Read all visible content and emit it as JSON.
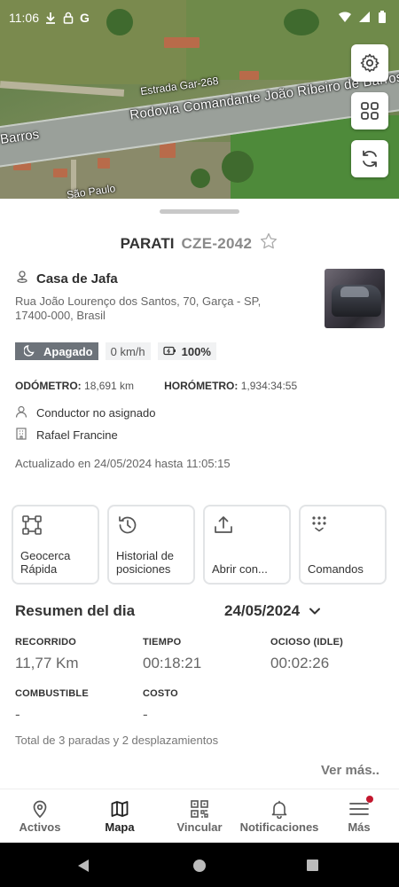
{
  "status_bar": {
    "time": "11:06",
    "google_letter": "G"
  },
  "map": {
    "labels": {
      "estrada": "Estrada Gar-268",
      "rodovia": "Rodovia Comandante João Ribeiro de Barros",
      "barros": "Barros",
      "sao_paulo": "São Paulo"
    },
    "buttons": [
      "gear-icon",
      "grid-icon",
      "refresh-icon"
    ]
  },
  "vehicle": {
    "name": "PARATI",
    "plate": "CZE-2042",
    "place": "Casa de Jafa",
    "address": "Rua João Lourenço dos Santos, 70, Garça - SP, 17400-000, Brasil",
    "status": "Apagado",
    "speed": "0 km/h",
    "battery": "100%",
    "odometer_label": "ODÓMETRO:",
    "odometer_value": "18,691 km",
    "hourmeter_label": "HORÓMETRO:",
    "hourmeter_value": "1,934:34:55",
    "driver": "Conductor no asignado",
    "owner": "Rafael Francine",
    "updated": "Actualizado en 24/05/2024 hasta 11:05:15"
  },
  "actions": [
    {
      "label": "Geocerca\nRápida",
      "icon": "geofence-icon"
    },
    {
      "label": "Historial de\nposiciones",
      "icon": "history-icon"
    },
    {
      "label": "Abrir con...",
      "icon": "share-icon"
    },
    {
      "label": "Comandos",
      "icon": "keypad-icon"
    }
  ],
  "summary": {
    "title": "Resumen del dia",
    "date": "24/05/2024",
    "stats": {
      "recorrido": {
        "label": "RECORRIDO",
        "value": "11,77 Km"
      },
      "tiempo": {
        "label": "TIEMPO",
        "value": "00:18:21"
      },
      "ocioso": {
        "label": "OCIOSO (IDLE)",
        "value": "00:02:26"
      },
      "combustible": {
        "label": "COMBUSTIBLE",
        "value": "-"
      },
      "costo": {
        "label": "COSTO",
        "value": "-"
      }
    },
    "total": "Total de 3 paradas y 2 desplazamientos",
    "more": "Ver más.."
  },
  "nav": {
    "items": [
      {
        "label": "Activos",
        "icon": "location-pin-icon"
      },
      {
        "label": "Mapa",
        "icon": "map-icon",
        "active": true
      },
      {
        "label": "Vincular",
        "icon": "qr-code-icon"
      },
      {
        "label": "Notificaciones",
        "icon": "bell-icon"
      },
      {
        "label": "Más",
        "icon": "menu-icon",
        "notification_dot": true
      }
    ]
  },
  "colors": {
    "accent_dot": "#c3172e",
    "status_badge": "#6d737a",
    "card_border": "#e2e4e6"
  }
}
